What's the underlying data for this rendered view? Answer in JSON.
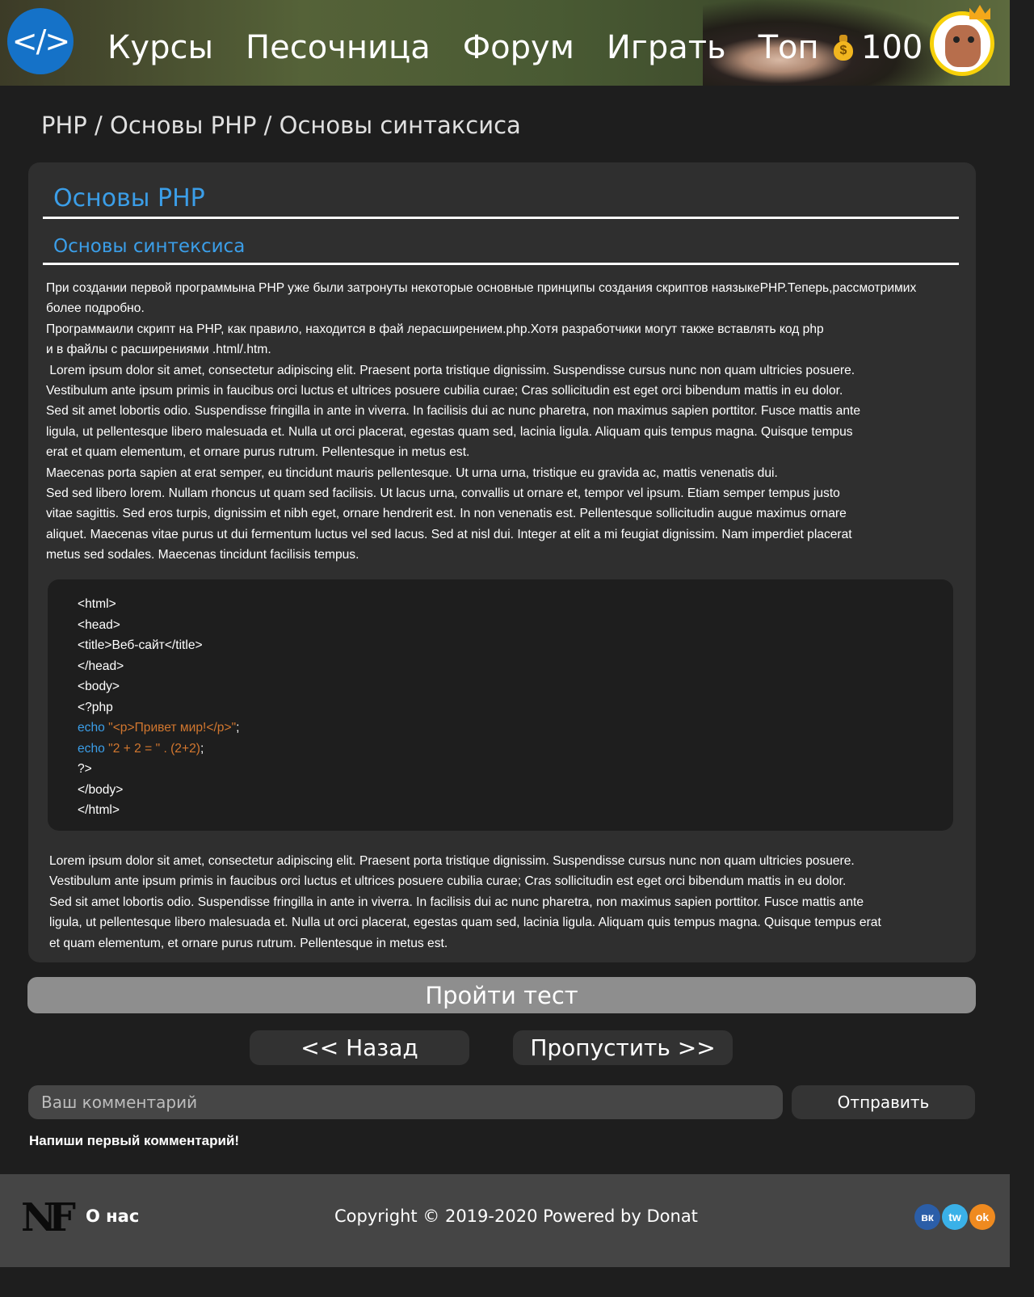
{
  "header": {
    "logo_text": "</>",
    "nav": [
      "Курсы",
      "Песочница",
      "Форум",
      "Играть",
      "Топ"
    ],
    "coin_symbol": "$",
    "coins": "100"
  },
  "breadcrumb": "PHP / Основы PHP / Основы синтаксиса",
  "lesson": {
    "title": "Основы PHP",
    "subtitle": "Основы синтексиса",
    "intro_lines": [
      "При создании первой программына PHP уже были затронуты некоторые основные принципы создания скриптов наязыкеPHP.Теперь,рассмотримих",
      "более подробно.",
      "Программаили скрипт на PHP, как правило, находится в фай лерасширением.php.Хотя разработчики могут также вставлять код php",
      "и в файлы с расширениями .html/.htm.",
      " Lorem ipsum dolor sit amet, consectetur adipiscing elit. Praesent porta tristique dignissim. Suspendisse cursus nunc non quam ultricies posuere.",
      "Vestibulum ante ipsum primis in faucibus orci luctus et ultrices posuere cubilia curae; Cras sollicitudin est eget orci bibendum mattis in eu dolor.",
      "Sed sit amet lobortis odio. Suspendisse fringilla in ante in viverra. In facilisis dui ac nunc pharetra, non maximus sapien porttitor. Fusce mattis ante",
      "ligula, ut pellentesque libero malesuada et. Nulla ut orci placerat, egestas quam sed, lacinia ligula. Aliquam quis tempus magna. Quisque tempus",
      "erat et quam elementum, et ornare purus rutrum. Pellentesque in metus est.",
      "Maecenas porta sapien at erat semper, eu tincidunt mauris pellentesque. Ut urna urna, tristique eu gravida ac, mattis venenatis dui.",
      "Sed sed libero lorem. Nullam rhoncus ut quam sed facilisis. Ut lacus urna, convallis ut ornare et, tempor vel ipsum. Etiam semper tempus justo",
      "vitae sagittis. Sed eros turpis, dignissim et nibh eget, ornare hendrerit est. In non venenatis est. Pellentesque sollicitudin augue maximus ornare",
      "aliquet. Maecenas vitae purus ut dui fermentum luctus vel sed lacus. Sed at nisl dui. Integer at elit a mi feugiat dignissim. Nam imperdiet placerat",
      "metus sed sodales. Maecenas tincidunt facilisis tempus."
    ],
    "code": {
      "l1": "<html>",
      "l2": "<head>",
      "l3": "<title>Веб-сайт</title>",
      "l4": "</head>",
      "l5": "<body>",
      "l6": "<?php",
      "l7_kw": "echo",
      "l7_str": " \"<p>Привет мир!</p>\"",
      "l7_end": ";",
      "l8_kw": "echo",
      "l8_str": " \"2 + 2 = \" . (2+2)",
      "l8_end": ";",
      "l9": "?>",
      "l10": "</body>",
      "l11": "</html>"
    },
    "outro_lines": [
      "Lorem ipsum dolor sit amet, consectetur adipiscing elit. Praesent porta tristique dignissim. Suspendisse cursus nunc non quam ultricies posuere.",
      "Vestibulum ante ipsum primis in faucibus orci luctus et ultrices posuere cubilia curae; Cras sollicitudin est eget orci bibendum mattis in eu dolor.",
      "Sed sit amet lobortis odio. Suspendisse fringilla in ante in viverra. In facilisis dui ac nunc pharetra, non maximus sapien porttitor. Fusce mattis ante",
      "ligula, ut pellentesque libero malesuada et. Nulla ut orci placerat, egestas quam sed, lacinia ligula. Aliquam quis tempus magna. Quisque tempus erat",
      "et quam elementum, et ornare purus rutrum. Pellentesque in metus est."
    ]
  },
  "actions": {
    "test_label": "Пройти тест",
    "back_label": "<< Назад",
    "skip_label": "Пропустить >>"
  },
  "comments": {
    "placeholder": "Ваш комментарий",
    "send_label": "Отправить",
    "empty_text": "Напиши первый комментарий!"
  },
  "footer": {
    "logo_text": "NF",
    "about_label": "О нас",
    "copyright": "Copyright © 2019-2020 Powered by Donat",
    "social": [
      "вк",
      "tw",
      "ok"
    ]
  },
  "colors": {
    "accent": "#3b9ee8",
    "code_string": "#d2772f",
    "background": "#1e1e1e",
    "card": "#2f2f2f",
    "footer": "#454545"
  }
}
